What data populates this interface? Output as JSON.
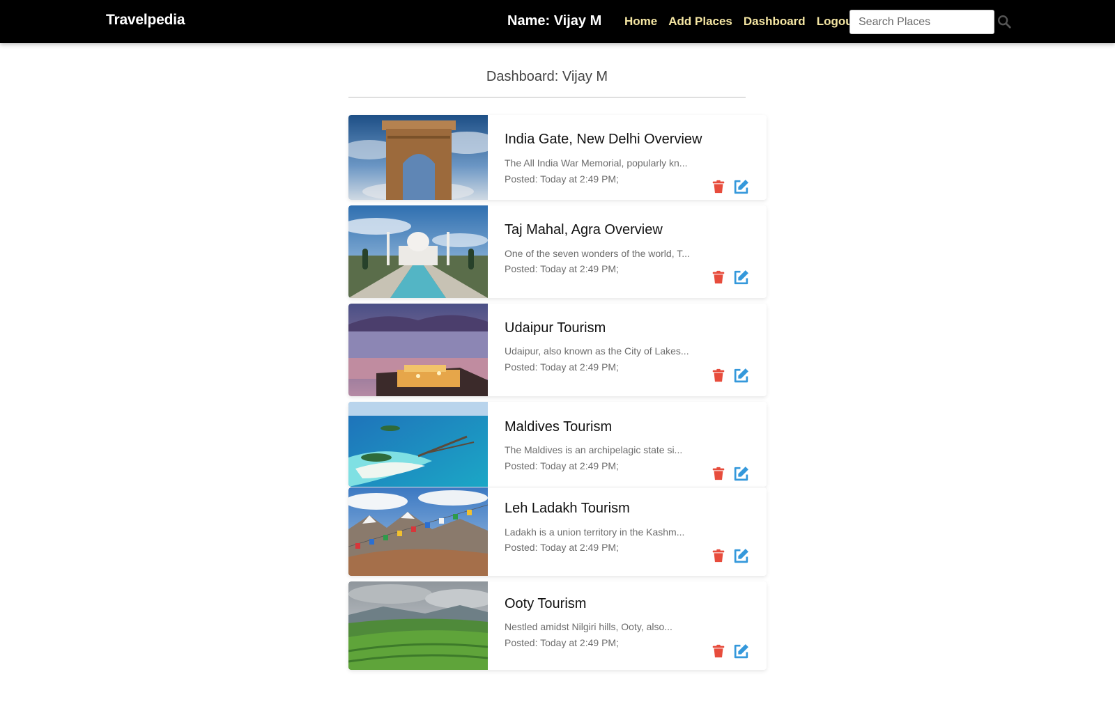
{
  "nav": {
    "brand": "Travelpedia",
    "user_label": "Name: Vijay M",
    "links": [
      "Home",
      "Add Places",
      "Dashboard",
      "Logout"
    ],
    "search_placeholder": "Search Places"
  },
  "dashboard": {
    "title": "Dashboard: Vijay M"
  },
  "places": [
    {
      "title": "India Gate, New Delhi Overview",
      "description": "The All India War Memorial, popularly kn...",
      "posted": "Posted: Today at 2:49 PM;"
    },
    {
      "title": "Taj Mahal, Agra Overview",
      "description": "One of the seven wonders of the world, T...",
      "posted": "Posted: Today at 2:49 PM;"
    },
    {
      "title": "Udaipur Tourism",
      "description": "Udaipur, also known as the City of Lakes...",
      "posted": "Posted: Today at 2:49 PM;"
    },
    {
      "title": "Maldives Tourism",
      "description": "The Maldives is an archipelagic state si...",
      "posted": "Posted: Today at 2:49 PM;"
    },
    {
      "title": "Leh Ladakh Tourism",
      "description": "Ladakh is a union territory in the Kashm...",
      "posted": "Posted: Today at 2:49 PM;"
    },
    {
      "title": "Ooty Tourism",
      "description": "Nestled amidst Nilgiri hills, Ooty, also...",
      "posted": "Posted: Today at 2:49 PM;"
    }
  ],
  "colors": {
    "nav_link": "#f5e6a3",
    "delete_icon": "#e74c3c",
    "edit_icon": "#3498db"
  },
  "icons": {
    "search": "search-icon",
    "delete": "trash-icon",
    "edit": "edit-icon"
  }
}
